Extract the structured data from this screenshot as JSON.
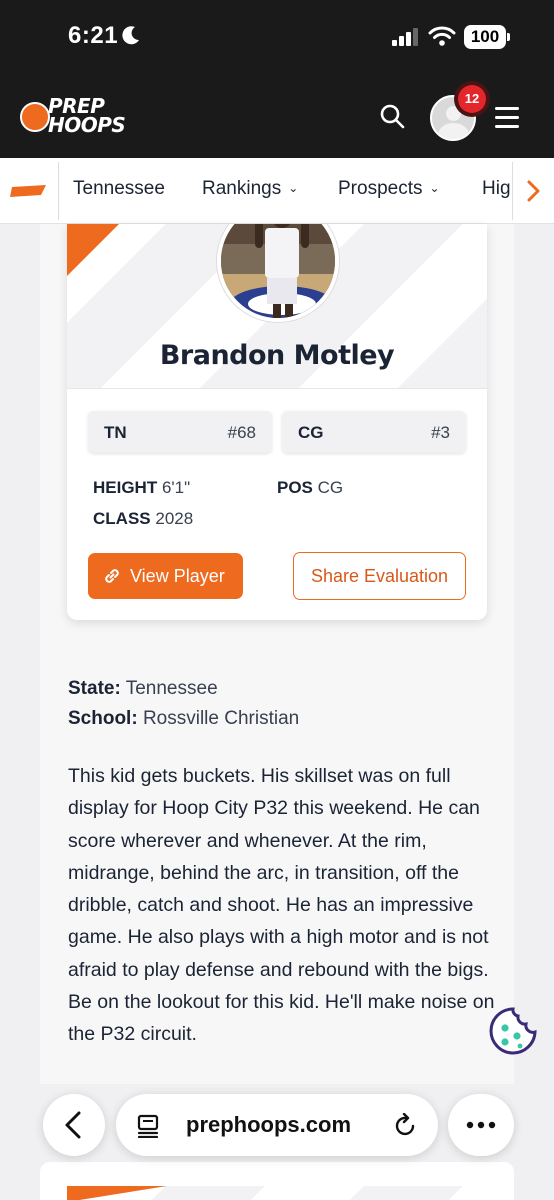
{
  "status_bar": {
    "time": "6:21",
    "battery": "100"
  },
  "header": {
    "notifications_count": "12"
  },
  "nav": {
    "items": [
      {
        "label": "Tennessee",
        "has_caret": false
      },
      {
        "label": "Rankings",
        "has_caret": true
      },
      {
        "label": "Prospects",
        "has_caret": true
      },
      {
        "label": "Hig",
        "has_caret": false
      }
    ]
  },
  "player_card": {
    "name": "Brandon Motley",
    "rankings": [
      {
        "label": "TN",
        "value": "#68"
      },
      {
        "label": "CG",
        "value": "#3"
      }
    ],
    "stats": {
      "height_label": "HEIGHT",
      "height_value": "6'1\"",
      "pos_label": "POS",
      "pos_value": "CG",
      "class_label": "CLASS",
      "class_value": "2028"
    },
    "view_button": "View Player",
    "share_button": "Share Evaluation"
  },
  "details": {
    "state_label": "State:",
    "state_value": "Tennessee",
    "school_label": "School:",
    "school_value": "Rossville Christian"
  },
  "evaluation": "This kid gets buckets. His skillset was on full display for Hoop City P32 this weekend. He can score wherever and whenever. At the rim, midrange, behind the arc, in transition, off the dribble, catch and shoot. He has an impressive game. He also plays with a high motor and is not afraid to play defense and rebound with the bigs. Be on the lookout for this kid. He'll make noise on the P32 circuit.",
  "browser": {
    "url": "prephoops.com"
  },
  "colors": {
    "accent": "#ee6a1f",
    "header_bg": "#1a1a1a",
    "text": "#1b2434"
  }
}
